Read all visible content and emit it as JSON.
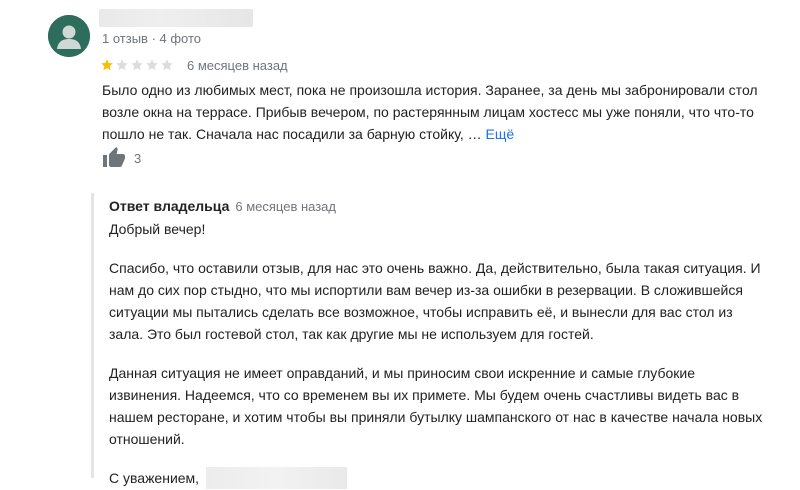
{
  "review": {
    "author_meta": "1 отзыв · 4 фото",
    "rating": 1,
    "max_rating": 5,
    "date": "6 месяцев назад",
    "text": "Было одно из любимых мест, пока не произошла история. Заранее, за день мы забронировали стол возле окна на террасе. Прибыв вечером, по растерянным лицам хостесс мы уже поняли, что что-то пошло не так. Сначала нас посадили за барную стойку, … ",
    "more_label": "Ещё",
    "likes": "3",
    "colors": {
      "star_filled": "#fbbc04",
      "star_empty": "#dadce0",
      "avatar_bg": "#2e6c5c",
      "link": "#1a73e8"
    },
    "icons": {
      "avatar": "person-icon",
      "like": "thumbs-up-icon"
    }
  },
  "owner_response": {
    "label": "Ответ владельца",
    "date": "6 месяцев назад",
    "greeting": "Добрый вечер!",
    "paragraphs": [
      "Спасибо, что оставили отзыв, для нас это очень важно. Да, действительно, была такая ситуация. И нам до сих пор стыдно, что мы испортили вам вечер из-за ошибки в резервации. В сложившейся ситуации мы пытались сделать все возможное, чтобы исправить её, и вынесли для вас стол из зала. Это был гостевой стол, так как другие мы не используем для гостей.",
      "Данная ситуация не имеет оправданий, и мы приносим свои искренние и самые глубокие извинения. Надеемся, что со временем вы их примете. Мы будем очень счастливы видеть вас в нашем ресторане, и хотим чтобы вы приняли бутылку шампанского от нас в качестве начала новых отношений."
    ],
    "signoff": "С уважением,"
  }
}
